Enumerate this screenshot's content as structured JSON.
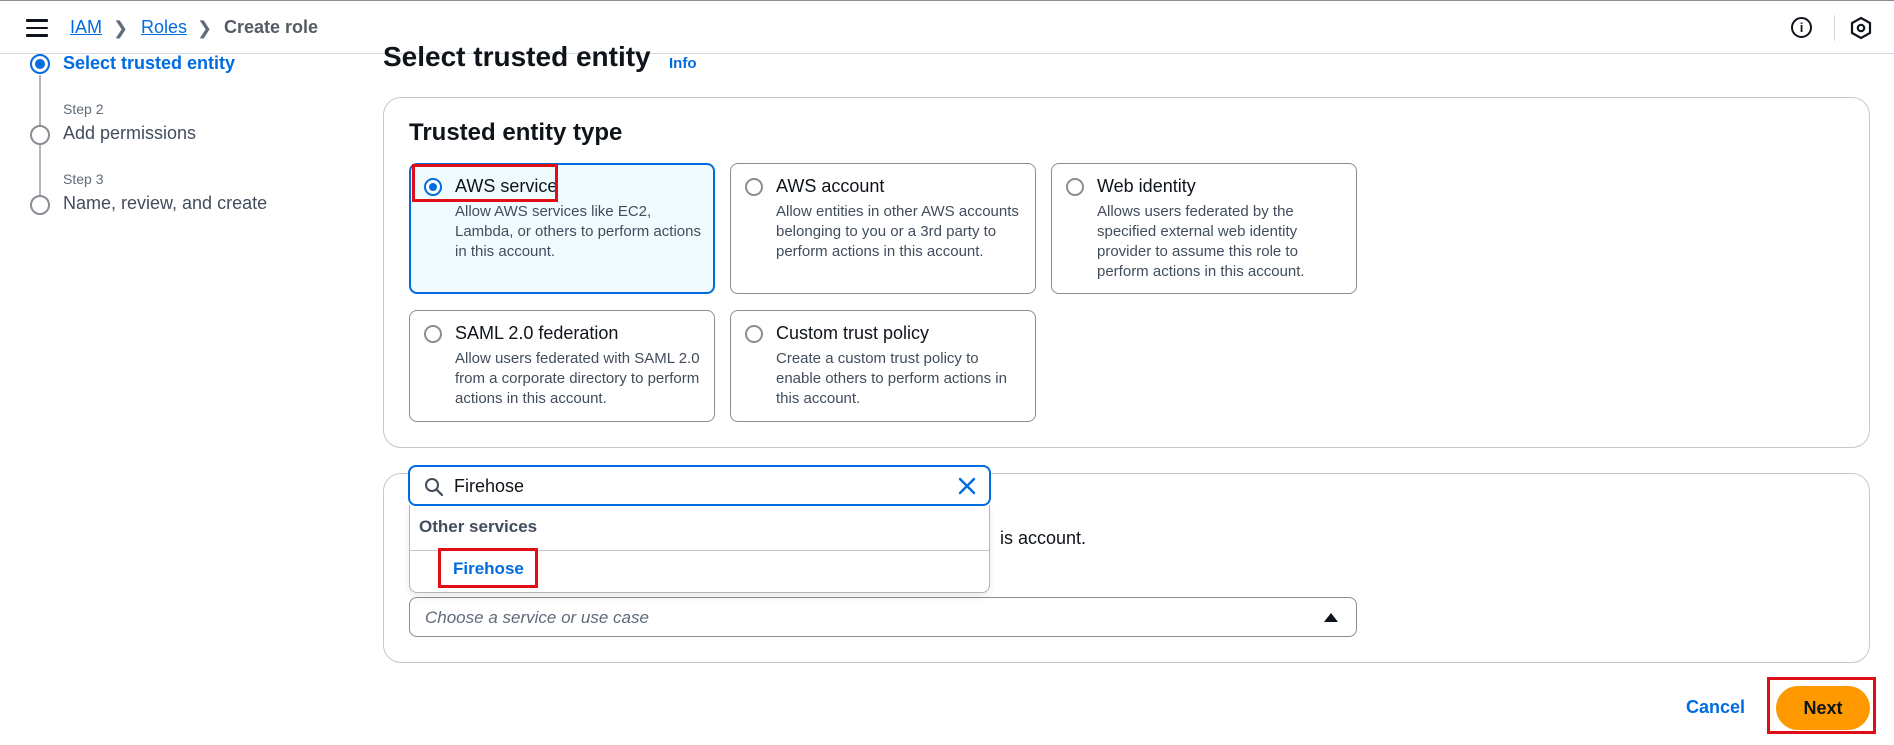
{
  "breadcrumb": {
    "items": [
      "IAM",
      "Roles",
      "Create role"
    ]
  },
  "steps": [
    {
      "number": "",
      "label": "Select trusted entity",
      "active": true
    },
    {
      "number": "Step 2",
      "label": "Add permissions",
      "active": false
    },
    {
      "number": "Step 3",
      "label": "Name, review, and create",
      "active": false
    }
  ],
  "page": {
    "title": "Select trusted entity",
    "info_link": "Info"
  },
  "trusted_entity": {
    "section_title": "Trusted entity type",
    "options": [
      {
        "title": "AWS service",
        "desc": "Allow AWS services like EC2, Lambda, or others to perform actions in this account.",
        "selected": true
      },
      {
        "title": "AWS account",
        "desc": "Allow entities in other AWS accounts belonging to you or a 3rd party to perform actions in this account.",
        "selected": false
      },
      {
        "title": "Web identity",
        "desc": "Allows users federated by the specified external web identity provider to assume this role to perform actions in this account.",
        "selected": false
      },
      {
        "title": "SAML 2.0 federation",
        "desc": "Allow users federated with SAML 2.0 from a corporate directory to perform actions in this account.",
        "selected": false
      },
      {
        "title": "Custom trust policy",
        "desc": "Create a custom trust policy to enable others to perform actions in this account.",
        "selected": false
      }
    ]
  },
  "use_case": {
    "partial_text": "is account.",
    "select_placeholder": "Choose a service or use case",
    "search_value": "Firehose",
    "dropdown_group": "Other services",
    "dropdown_item": "Firehose"
  },
  "footer": {
    "cancel_label": "Cancel",
    "next_label": "Next"
  },
  "colors": {
    "accent": "#006ce0",
    "primary_button": "#ff9900",
    "highlight_box": "#e00e17"
  }
}
